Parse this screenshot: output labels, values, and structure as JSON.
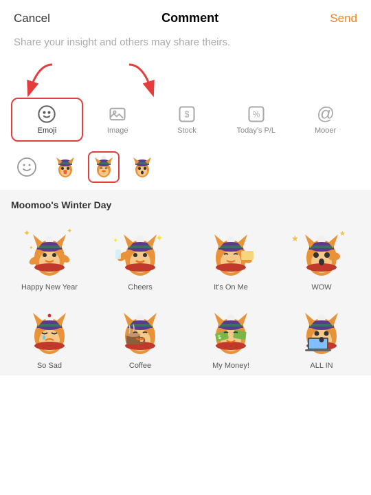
{
  "header": {
    "cancel_label": "Cancel",
    "title": "Comment",
    "send_label": "Send"
  },
  "subtitle": "Share your insight and others may share theirs.",
  "toolbar": {
    "items": [
      {
        "id": "emoji",
        "label": "Emoji",
        "active": true
      },
      {
        "id": "image",
        "label": "Image",
        "active": false
      },
      {
        "id": "stock",
        "label": "Stock",
        "active": false
      },
      {
        "id": "pnl",
        "label": "Today's P/L",
        "active": false
      },
      {
        "id": "mooer",
        "label": "Mooer",
        "active": false
      }
    ]
  },
  "emoji_subrow": {
    "items": [
      {
        "type": "smiley",
        "selected": false
      },
      {
        "type": "fox1",
        "selected": false
      },
      {
        "type": "fox2",
        "selected": true
      },
      {
        "type": "fox3",
        "selected": false
      }
    ]
  },
  "sticker_section": {
    "title": "Moomoo's Winter Day",
    "stickers": [
      {
        "name": "Happy New Year"
      },
      {
        "name": "Cheers"
      },
      {
        "name": "It's On Me"
      },
      {
        "name": "WOW"
      },
      {
        "name": "So Sad"
      },
      {
        "name": "Coffee"
      },
      {
        "name": "My Money!"
      },
      {
        "name": "ALL IN"
      }
    ]
  },
  "colors": {
    "send": "#f7801a",
    "active_border": "#e53c3c",
    "bg": "#f5f5f5"
  }
}
